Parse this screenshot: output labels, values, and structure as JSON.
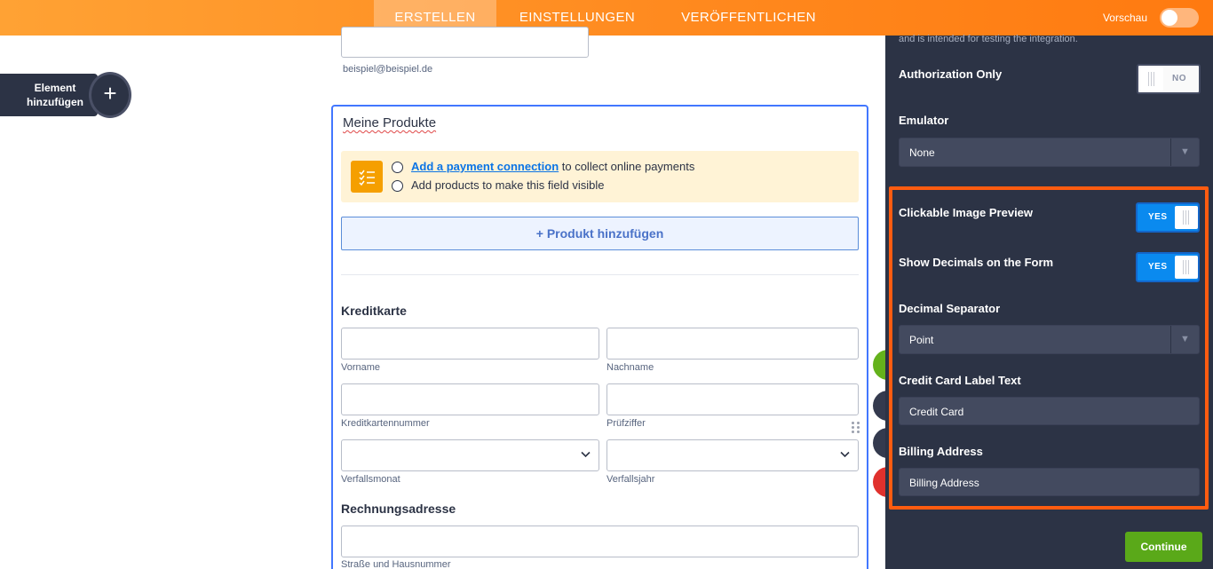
{
  "topbar": {
    "tabs": [
      {
        "label": "ERSTELLEN",
        "active": true
      },
      {
        "label": "EINSTELLUNGEN",
        "active": false
      },
      {
        "label": "VERÖFFENTLICHEN",
        "active": false
      }
    ],
    "preview_label": "Vorschau",
    "preview_on": false
  },
  "left": {
    "add_element_label": "Element hinzufügen",
    "add_element_icon": "plus-icon"
  },
  "form": {
    "email_sublabel": "beispiel@beispiel.de",
    "products_title": "Meine Produkte",
    "notice": {
      "icon": "checklist-icon",
      "line1_link": "Add a payment connection",
      "line1_rest": " to collect online payments",
      "line2": "Add products to make this field visible"
    },
    "add_product_label": "+ Produkt hinzufügen",
    "credit_card_title": "Kreditkarte",
    "fields": {
      "first_name": "Vorname",
      "last_name": "Nachname",
      "card_number": "Kreditkartennummer",
      "cvv": "Prüfziffer",
      "exp_month": "Verfallsmonat",
      "exp_year": "Verfallsjahr"
    },
    "billing_title": "Rechnungsadresse",
    "street_sublabel": "Straße und Hausnummer"
  },
  "panel": {
    "note": "and is intended for testing the integration.",
    "auth_only_label": "Authorization Only",
    "auth_only_value": "NO",
    "emulator_label": "Emulator",
    "emulator_value": "None",
    "clickable_preview_label": "Clickable Image Preview",
    "clickable_preview_value": "YES",
    "show_decimals_label": "Show Decimals on the Form",
    "show_decimals_value": "YES",
    "decimal_separator_label": "Decimal Separator",
    "decimal_separator_value": "Point",
    "cc_label_text_label": "Credit Card Label Text",
    "cc_label_text_value": "Credit Card",
    "billing_address_label": "Billing Address",
    "billing_address_value": "Billing Address",
    "continue_label": "Continue"
  },
  "colors": {
    "topbar": "#ff8a1f",
    "panel": "#2c3345",
    "highlight": "#ff5c10",
    "continue": "#5aa919",
    "toggle_yes": "#0a8aef",
    "link": "#0b74e5"
  }
}
